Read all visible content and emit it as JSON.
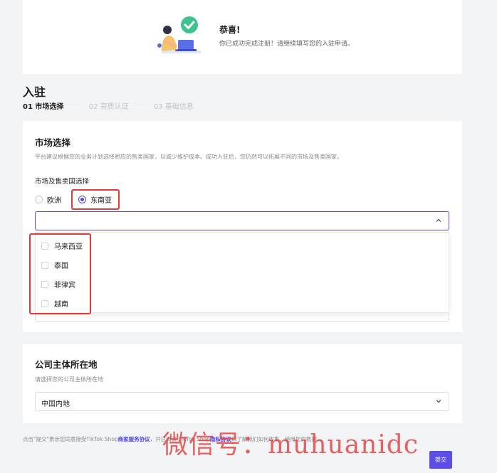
{
  "congrats": {
    "title": "恭喜!",
    "subtitle": "你已成功完成注册！请继续填写您的入驻申请。"
  },
  "page": {
    "title": "入驻",
    "steps": [
      "01 市场选择",
      "02 资质认证",
      "03 基础信息"
    ],
    "step_separator": "·····"
  },
  "market": {
    "title": "市场选择",
    "description": "平台建议根据您的业务计划选择相应的售卖国家，以减少维护成本。成功入驻后，您仍然可以拓展不同的市场及售卖国家。",
    "field_label": "市场及售卖国选择",
    "radio_options": [
      "欧洲",
      "东南亚"
    ],
    "selected_region": "东南亚",
    "countries": [
      "马来西亚",
      "泰国",
      "菲律宾",
      "越南"
    ]
  },
  "company": {
    "title": "公司主体所在地",
    "description": "请选择您的公司主体所在地",
    "selected": "中国内地"
  },
  "footer": {
    "prefix": "点击\"提交\"表示您同意接受TikTok Shop",
    "link1": "商家服务协议",
    "middle": "，并已阅读 TikTok Shop",
    "link2": "隐私协议",
    "suffix": "以了解我们如何收集、使用您的数据。"
  },
  "submit_label": "提交",
  "watermark": "微信号：muhuanidc",
  "colors": {
    "accent": "#5b4ee8",
    "highlight": "#e03a3a",
    "watermark": "#e23f3f"
  }
}
